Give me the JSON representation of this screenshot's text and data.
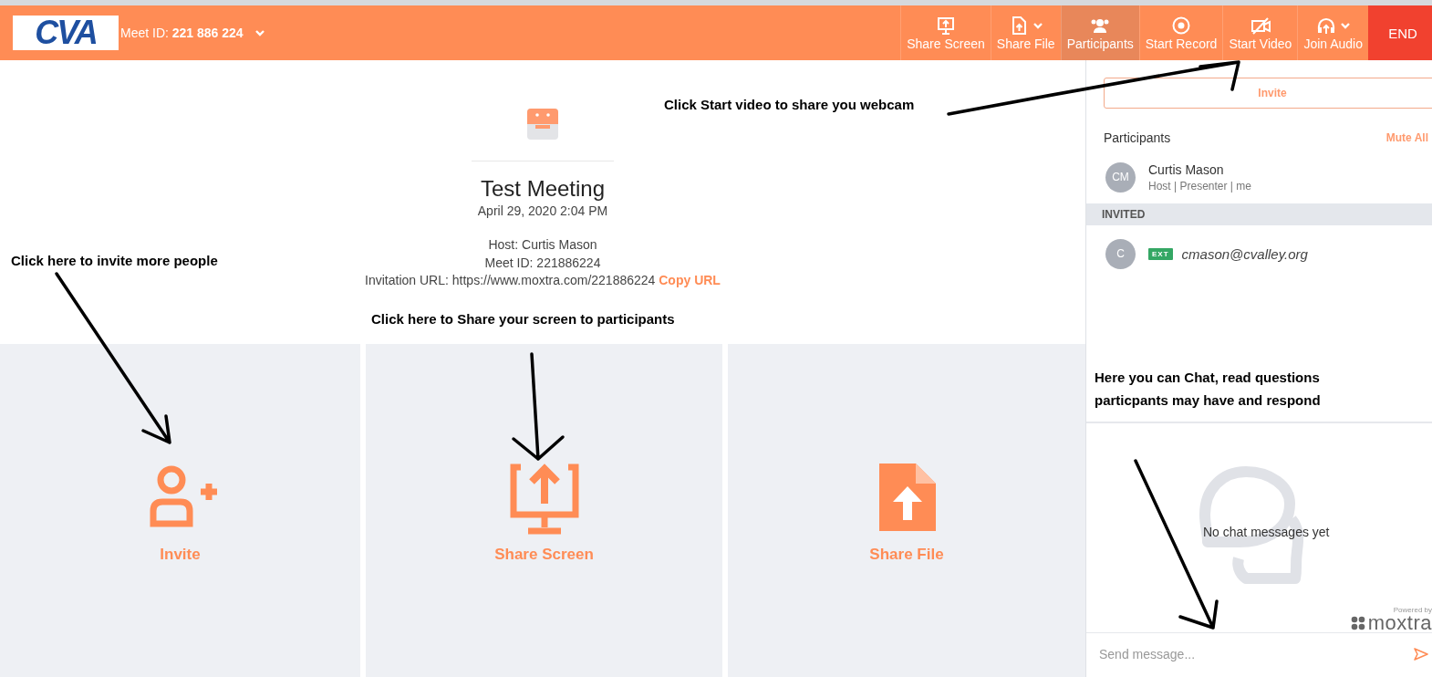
{
  "header": {
    "logo": "CVA",
    "meet_id_label": "Meet ID:",
    "meet_id": "221 886 224"
  },
  "toolbar": {
    "items": [
      {
        "kind": "share-screen",
        "label": "Share Screen",
        "caret": false,
        "selected": false
      },
      {
        "kind": "share-file",
        "label": "Share File",
        "caret": true,
        "selected": false
      },
      {
        "kind": "participants",
        "label": "Participants",
        "caret": false,
        "selected": true
      },
      {
        "kind": "start-record",
        "label": "Start Record",
        "caret": false,
        "selected": false
      },
      {
        "kind": "start-video",
        "label": "Start Video",
        "caret": false,
        "selected": false
      },
      {
        "kind": "join-audio",
        "label": "Join Audio",
        "caret": true,
        "selected": false
      }
    ],
    "end_button": "END"
  },
  "meeting": {
    "title": "Test Meeting",
    "date": "April 29, 2020 2:04 PM",
    "host": "Host: Curtis Mason",
    "meet_id": "Meet ID: 221886224",
    "invitation": "Invitation URL: https://www.moxtra.com/221886224",
    "copy_link": "Copy URL"
  },
  "tiles": [
    {
      "kind": "invite",
      "label": "Invite"
    },
    {
      "kind": "share-screen",
      "label": "Share Screen"
    },
    {
      "kind": "share-file",
      "label": "Share File"
    }
  ],
  "sidebar": {
    "invite_button": "Invite",
    "participants_title": "Participants",
    "mute_all": "Mute All",
    "participants": [
      {
        "initials": "CM",
        "name": "Curtis Mason",
        "roles": "Host | Presenter | me"
      }
    ],
    "invited_title": "INVITED",
    "invited": [
      {
        "initials": "C",
        "badge": "EXT",
        "email": "cmason@cvalley.org"
      }
    ],
    "chat": {
      "empty_text": "No chat messages yet",
      "powered_by": "Powered by",
      "brand": "moxtra",
      "placeholder": "Send message..."
    }
  },
  "annotations": [
    {
      "lines": [
        "Click Start video to share you webcam"
      ]
    },
    {
      "lines": [
        "Click here to invite more people"
      ]
    },
    {
      "lines": [
        "Click here to Share your screen to participants"
      ]
    },
    {
      "lines": [
        "Here you can Chat, read questions",
        "particpants may have and respond"
      ]
    }
  ]
}
